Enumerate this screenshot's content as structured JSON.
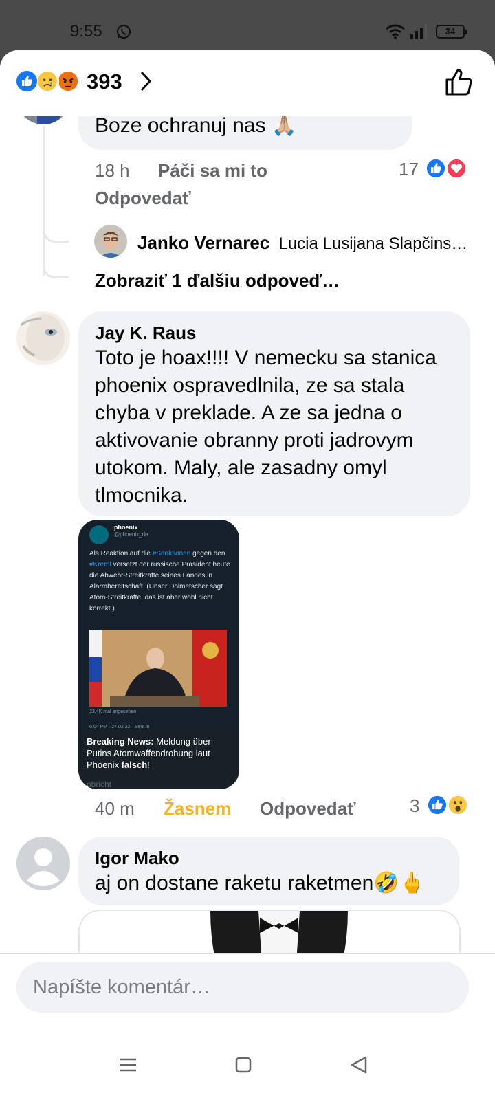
{
  "status_bar": {
    "time": "9:55",
    "battery": "34"
  },
  "header": {
    "reaction_icons": [
      "like-icon",
      "sad-icon",
      "angry-icon"
    ],
    "reaction_count": "393"
  },
  "comments": {
    "c1": {
      "text": "Boze ochranuj nas 🙏🏼",
      "time": "18 h",
      "like_label": "Páči sa mi to",
      "reply_label": "Odpovedať",
      "reaction_count": "17",
      "reply_preview": {
        "author": "Janko Vernarec",
        "text": "Lucia Lusijana Slapčins…"
      },
      "more_replies": "Zobraziť 1 ďalšiu odpoveď…"
    },
    "c2": {
      "author": "Jay K. Raus",
      "text": "Toto je hoax!!!! V nemecku sa stanica phoenix ospravedlnila, ze sa stala chyba v preklade. A ze sa jedna o aktivovanie obranny proti jadrovym utokom. Maly, ale zasadny omyl tlmocnika.",
      "time": "40 m",
      "reaction_label": "Žasnem",
      "reply_label": "Odpovedať",
      "reaction_count": "3",
      "tweet": {
        "name": "phoenix",
        "handle": "@phoenix_de",
        "text_1": "Als Reaktion auf die ",
        "hashtag_1": "#Sanktionen",
        "text_2": " gegen den ",
        "hashtag_2": "#Kreml",
        "text_3": " versetzt der russische Präsident heute die Abwehr-Streitkräfte seines Landes in Alarmbereitschaft. (Unser Dolmetscher sagt Atom-Streitkräfte, das ist aber wohl nicht korrekt.)",
        "views": "23,4K mal angesehen",
        "date": "6:04 PM · 27.02.22 · Sent in",
        "caption_bold": "Breaking News:",
        "caption_text": " Meldung über Putins Atomwaffendrohung laut Phoenix ",
        "caption_link": "falsch",
        "caption_end": "!",
        "faint": "nbricht"
      }
    },
    "c3": {
      "author": "Igor Mako",
      "text": "aj on dostane raketu raketmen🤣🖕"
    }
  },
  "composer": {
    "placeholder": "Napíšte komentár…"
  },
  "colors": {
    "like_blue": "#1877f2",
    "love_red": "#f33e58",
    "wow_yellow": "#f7b125",
    "bubble_bg": "#f0f2f5",
    "meta_gray": "#65676b"
  }
}
